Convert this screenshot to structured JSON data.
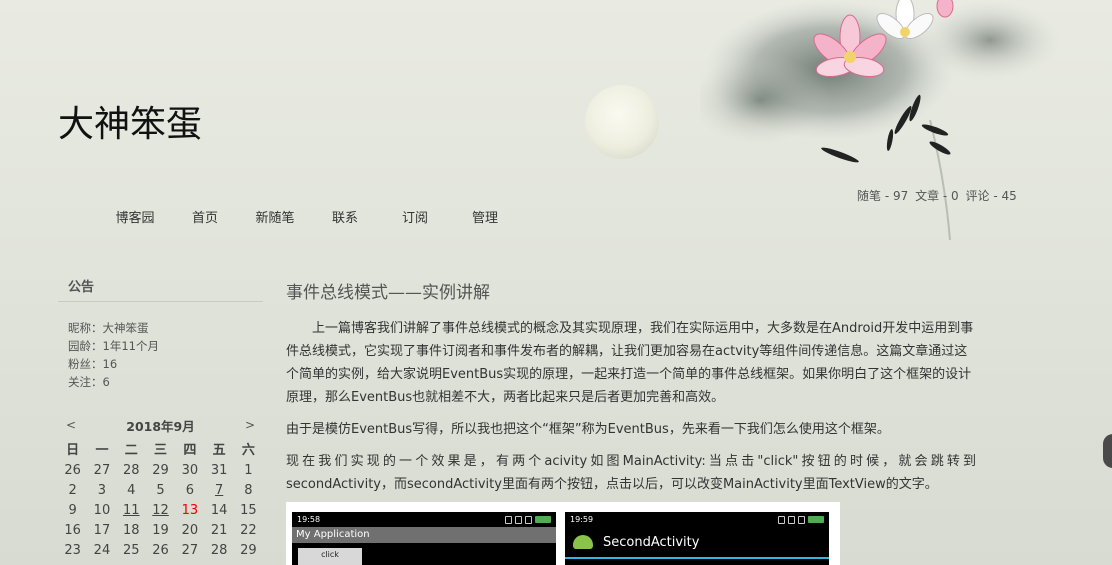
{
  "header": {
    "blog_title": "大神笨蛋"
  },
  "nav": [
    {
      "label": "博客园"
    },
    {
      "label": "首页"
    },
    {
      "label": "新随笔"
    },
    {
      "label": "联系"
    },
    {
      "label": "订阅"
    },
    {
      "label": "管理"
    }
  ],
  "stats": {
    "posts": "随笔 - 97",
    "articles": "文章 - 0",
    "comments": "评论 - 45"
  },
  "sidebar": {
    "notice_title": "公告",
    "nickname": "昵称：大神笨蛋",
    "age": "园龄：1年11个月",
    "fans": "粉丝：16",
    "follows": "关注：6"
  },
  "calendar": {
    "prev": "<",
    "next": ">",
    "month": "2018年9月",
    "weekdays": [
      "日",
      "一",
      "二",
      "三",
      "四",
      "五",
      "六"
    ],
    "weeks": [
      [
        "26",
        "27",
        "28",
        "29",
        "30",
        "31",
        "1"
      ],
      [
        "2",
        "3",
        "4",
        "5",
        "6",
        "7",
        "8"
      ],
      [
        "9",
        "10",
        "11",
        "12",
        "13",
        "14",
        "15"
      ],
      [
        "16",
        "17",
        "18",
        "19",
        "20",
        "21",
        "22"
      ],
      [
        "23",
        "24",
        "25",
        "26",
        "27",
        "28",
        "29"
      ]
    ],
    "linked_days": [
      "7",
      "11",
      "12"
    ],
    "today": "13"
  },
  "post": {
    "title": "事件总线模式——实例讲解",
    "p1": "上一篇博客我们讲解了事件总线模式的概念及其实现原理，我们在实际运用中，大多数是在Android开发中运用到事件总线模式，它实现了事件订阅者和事件发布者的解耦，让我们更加容易在actvity等组件间传递信息。这篇文章通过这个简单的实例，给大家说明EventBus实现的原理，一起来打造一个简单的事件总线框架。如果你明白了这个框架的设计原理，那么EventBus也就相差不大，两者比起来只是后者更加完善和高效。",
    "p2": "由于是模仿EventBus写得，所以我也把这个“框架”称为EventBus，先来看一下我们怎么使用这个框架。",
    "p3": "现在我们实现的一个效果是，有两个acivity如图MainActivity:当点击\"click\"按钮的时候，就会跳转到secondActivity，而secondActivity里面有两个按钮，点击以后，可以改变MainActivity里面TextView的文字。"
  },
  "screenshots": {
    "phone1": {
      "time": "19:58",
      "app_title": "My Application",
      "button": "click"
    },
    "phone2": {
      "time": "19:59",
      "app_title": "SecondActivity"
    }
  },
  "colors": {
    "today": "#e00000",
    "background": "#e2e5dc",
    "actionbar_accent": "#33b5e5",
    "android_green": "#8bc34a"
  }
}
